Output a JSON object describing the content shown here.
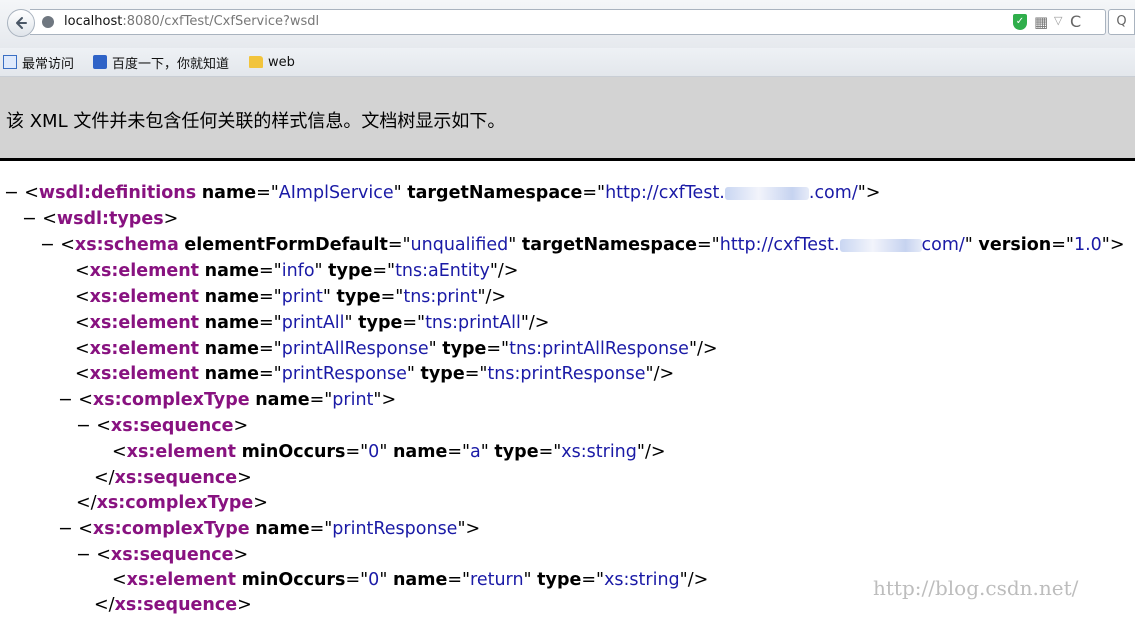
{
  "navbar": {
    "back_icon": "back-arrow-icon",
    "url_host": "localhost",
    "url_rest": ":8080/cxfTest/CxfService?wsdl",
    "qr_glyph": "▦",
    "dropdown_glyph": "▽",
    "reload_glyph": "C",
    "search_glyph": "Q",
    "shield_glyph": "✓"
  },
  "bookmarks": {
    "items": [
      {
        "label": "最常访问",
        "icon": "bookmark-icon"
      },
      {
        "label": "百度一下，你就知道",
        "icon": "baidu-paw-icon"
      },
      {
        "label": "web",
        "icon": "folder-icon"
      }
    ]
  },
  "notice": {
    "text": "该 XML 文件并未包含任何关联的样式信息。文档树显示如下。"
  },
  "xml": {
    "defs_tag": "wsdl:definitions",
    "defs_name": "AImplService",
    "defs_ns_start": "http://cxfTest.",
    "defs_ns_end": ".com/",
    "types_tag": "wsdl:types",
    "schema_tag": "xs:schema",
    "schema_efd": "unqualified",
    "schema_ns_start": "http://cxfTest.",
    "schema_ns_end": "com/",
    "schema_version": "1.0",
    "elements": [
      {
        "name": "info",
        "type": "tns:aEntity"
      },
      {
        "name": "print",
        "type": "tns:print"
      },
      {
        "name": "printAll",
        "type": "tns:printAll"
      },
      {
        "name": "printAllResponse",
        "type": "tns:printAllResponse"
      },
      {
        "name": "printResponse",
        "type": "tns:printResponse"
      }
    ],
    "complex1_name": "print",
    "complex1_el": {
      "minOccurs": "0",
      "name": "a",
      "type": "xs:string"
    },
    "complex2_name": "printResponse",
    "complex2_el": {
      "minOccurs": "0",
      "name": "return",
      "type": "xs:string"
    }
  },
  "watermark": "http://blog.csdn.net/"
}
